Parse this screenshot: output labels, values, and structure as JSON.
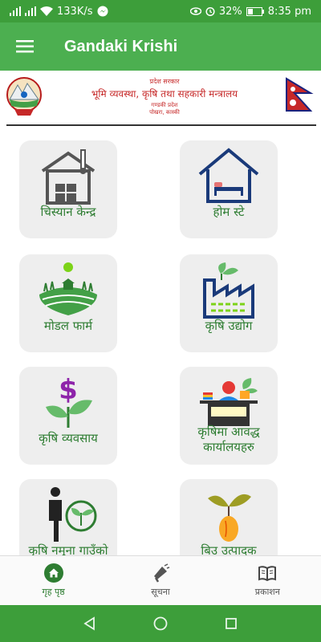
{
  "status": {
    "speed": "133K/s",
    "battery": "32%",
    "time": "8:35 pm"
  },
  "app": {
    "title": "Gandaki Krishi"
  },
  "gov_header": {
    "line1": "प्रदेश सरकार",
    "line2": "भूमि व्यवस्था, कृषि तथा सहकारी मन्त्रालय",
    "line3": "गण्डकी प्रदेश",
    "line4": "पोखरा, कास्की"
  },
  "tiles": [
    {
      "label": "चिस्यान केन्द्र",
      "icon": "cold-storage-icon"
    },
    {
      "label": "होम स्टे",
      "icon": "home-stay-icon"
    },
    {
      "label": "मोडल फार्म",
      "icon": "model-farm-icon"
    },
    {
      "label": "कृषि उद्योग",
      "icon": "agro-industry-icon"
    },
    {
      "label": "कृषि व्यवसाय",
      "icon": "agri-business-icon"
    },
    {
      "label": "कृषिमा आवद्ध\nकार्यालयहरु",
      "icon": "office-desk-icon"
    },
    {
      "label": "कृषि नमुना गाउँको",
      "icon": "farmer-icon"
    },
    {
      "label": "बिउ उत्पादक",
      "icon": "seed-icon"
    }
  ],
  "bottom_nav": [
    {
      "label": "गृह पृष्ठ",
      "icon": "home-icon",
      "active": true
    },
    {
      "label": "सूचना",
      "icon": "megaphone-icon",
      "active": false
    },
    {
      "label": "प्रकाशन",
      "icon": "book-icon",
      "active": false
    }
  ],
  "colors": {
    "primary": "#4caf50",
    "status": "#3d9e3a",
    "label": "#2e7d32",
    "tile_bg": "#eeeeee"
  }
}
